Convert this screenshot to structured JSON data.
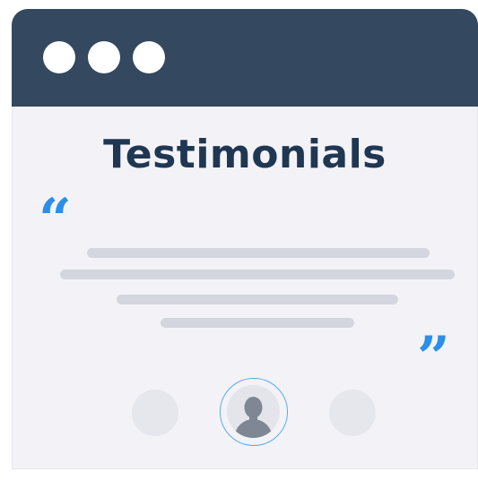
{
  "window": {
    "title_bar_buttons": [
      "window-dot",
      "window-dot",
      "window-dot"
    ]
  },
  "content": {
    "title": "Testimonials",
    "open_quote": "“",
    "close_quote": "”",
    "text_placeholder_lines": 4
  },
  "carousel": {
    "avatars": [
      "previous",
      "current",
      "next"
    ],
    "current_icon": "user-icon"
  },
  "colors": {
    "title_bar": "#34485f",
    "title_text": "#1f3752",
    "quote_accent": "#2d8ee8",
    "placeholder_line": "#d3d6de",
    "page_background": "#f3f3f7"
  }
}
